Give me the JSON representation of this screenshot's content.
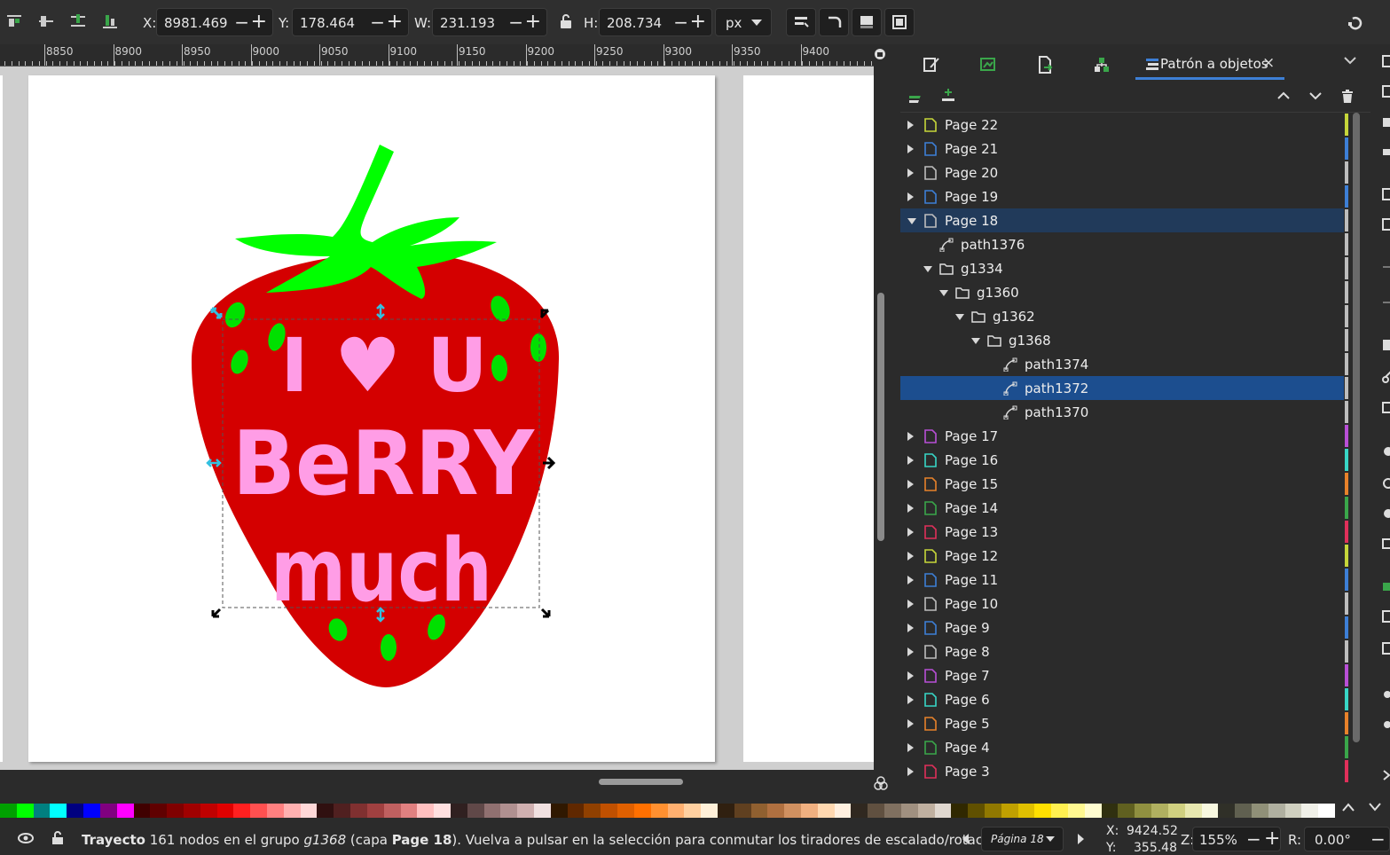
{
  "toolbar": {
    "x_label": "X:",
    "x_value": "8981.469",
    "y_label": "Y:",
    "y_value": "178.464",
    "w_label": "W:",
    "w_value": "231.193",
    "h_label": "H:",
    "h_value": "208.734",
    "unit": "px"
  },
  "ruler": {
    "labels": [
      "8850",
      "8900",
      "8950",
      "9000",
      "9050",
      "9100",
      "9150",
      "9200",
      "9250",
      "9300",
      "9350",
      "9400"
    ]
  },
  "artwork": {
    "line1": "I ♥ U",
    "line2": "BeRRY",
    "line3": "much"
  },
  "panel": {
    "active_tab_label": "Patrón a objetos",
    "tree": [
      {
        "label": "Page 22",
        "color": "#c6d63a"
      },
      {
        "label": "Page 21",
        "color": "#3d7fd6"
      },
      {
        "label": "Page 20",
        "color": "#bdbdbd"
      },
      {
        "label": "Page 19",
        "color": "#3d7fd6"
      },
      {
        "label": "Page 18",
        "color": "#bdbdbd"
      },
      {
        "label": "path1376",
        "color": "#bdbdbd"
      },
      {
        "label": "g1334",
        "color": "#bdbdbd"
      },
      {
        "label": "g1360",
        "color": "#bdbdbd"
      },
      {
        "label": "g1362",
        "color": "#bdbdbd"
      },
      {
        "label": "g1368",
        "color": "#bdbdbd"
      },
      {
        "label": "path1374",
        "color": "#bdbdbd"
      },
      {
        "label": "path1372",
        "color": "#bdbdbd"
      },
      {
        "label": "path1370",
        "color": "#bdbdbd"
      },
      {
        "label": "Page 17",
        "color": "#b84fd6"
      },
      {
        "label": "Page 16",
        "color": "#38d6c6"
      },
      {
        "label": "Page 15",
        "color": "#e8822a"
      },
      {
        "label": "Page 14",
        "color": "#3aa64a"
      },
      {
        "label": "Page 13",
        "color": "#e0305a"
      },
      {
        "label": "Page 12",
        "color": "#c6d63a"
      },
      {
        "label": "Page 11",
        "color": "#3d7fd6"
      },
      {
        "label": "Page 10",
        "color": "#bdbdbd"
      },
      {
        "label": "Page 9",
        "color": "#3d7fd6"
      },
      {
        "label": "Page 8",
        "color": "#bdbdbd"
      },
      {
        "label": "Page 7",
        "color": "#b84fd6"
      },
      {
        "label": "Page 6",
        "color": "#38d6c6"
      },
      {
        "label": "Page 5",
        "color": "#e8822a"
      },
      {
        "label": "Page 4",
        "color": "#3aa64a"
      },
      {
        "label": "Page 3",
        "color": "#e0305a"
      }
    ]
  },
  "status": {
    "type_bold": "Trayecto",
    "text_a": " 161 nodos en el grupo ",
    "group_italic": "g1368",
    "text_b": " (capa ",
    "layer_bold": "Page 18",
    "text_c": "). Vuelva a pulsar en la selección para conmutar los tiradores de escalado/rotación.",
    "page_selector": "Página 18",
    "x_label": "X:",
    "x_value": "9424.52",
    "y_label": "Y:",
    "y_value": "355.48",
    "zoom_label": "Z:",
    "zoom_value": "155%",
    "rot_label": "R:",
    "rot_value": "0.00°"
  },
  "palette": [
    "#00a000",
    "#00ff00",
    "#008080",
    "#00ffff",
    "#000080",
    "#0000ff",
    "#800080",
    "#ff00ff",
    "#400000",
    "#600000",
    "#800000",
    "#a00000",
    "#c00000",
    "#e00000",
    "#ff2020",
    "#ff5050",
    "#ff8080",
    "#ffb0b0",
    "#ffd8d8",
    "#301010",
    "#502020",
    "#803030",
    "#a04040",
    "#c06060",
    "#e08080",
    "#ffc0c0",
    "#ffe0e0",
    "#302020",
    "#604848",
    "#907070",
    "#b09090",
    "#d0b0b0",
    "#f0e0e0",
    "#301800",
    "#602800",
    "#904000",
    "#c05000",
    "#e06000",
    "#ff7000",
    "#ff9030",
    "#ffb070",
    "#ffd0a0",
    "#fff0d8",
    "#302010",
    "#604020",
    "#906030",
    "#b07040",
    "#d09060",
    "#f0b080",
    "#ffd8b0",
    "#fff0e0",
    "#302820",
    "#605040",
    "#807060",
    "#a09080",
    "#c0b0a0",
    "#e0d8d0",
    "#302800",
    "#605000",
    "#907800",
    "#c0a000",
    "#e0c000",
    "#ffe000",
    "#fff050",
    "#fff890",
    "#fffcd0",
    "#303010",
    "#606020",
    "#909040",
    "#b0b060",
    "#d0d080",
    "#e8e8b0",
    "#f8f8e0",
    "#303028",
    "#606050",
    "#909078",
    "#b0b0a0",
    "#d0d0c0",
    "#f0f0e8",
    "#ffffff"
  ]
}
